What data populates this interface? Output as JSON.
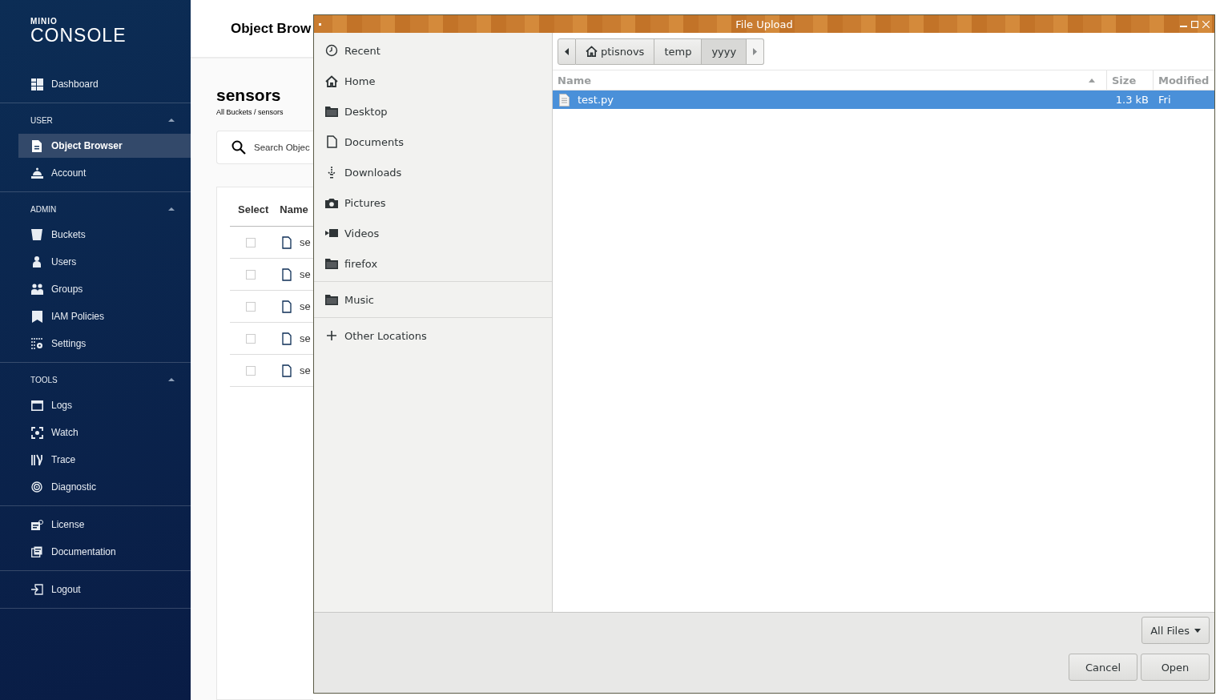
{
  "sidebar": {
    "logo_small": "MINIO",
    "logo": "CONSOLE",
    "sections": [
      {
        "items": [
          {
            "label": "Dashboard",
            "selected": false
          }
        ]
      },
      {
        "title": "USER",
        "expanded": true,
        "items": [
          {
            "label": "Object Browser",
            "selected": true
          },
          {
            "label": "Account",
            "selected": false
          }
        ]
      },
      {
        "title": "ADMIN",
        "expanded": true,
        "items": [
          {
            "label": "Buckets",
            "selected": false
          },
          {
            "label": "Users",
            "selected": false
          },
          {
            "label": "Groups",
            "selected": false
          },
          {
            "label": "IAM Policies",
            "selected": false
          },
          {
            "label": "Settings",
            "selected": false
          }
        ]
      },
      {
        "title": "TOOLS",
        "expanded": true,
        "items": [
          {
            "label": "Logs",
            "selected": false
          },
          {
            "label": "Watch",
            "selected": false
          },
          {
            "label": "Trace",
            "selected": false
          },
          {
            "label": "Diagnostic",
            "selected": false
          }
        ]
      },
      {
        "items": [
          {
            "label": "License",
            "selected": false
          },
          {
            "label": "Documentation",
            "selected": false
          }
        ]
      },
      {
        "items": [
          {
            "label": "Logout",
            "selected": false
          }
        ]
      }
    ]
  },
  "main": {
    "header_title": "Object Brow",
    "bucket": "sensors",
    "breadcrumb": "All Buckets / sensors",
    "search": {
      "placeholder": "Search Objec"
    },
    "table": {
      "columns": [
        "Select",
        "Name"
      ],
      "rows": [
        {
          "checked": false,
          "name": "se"
        },
        {
          "checked": false,
          "name": "se"
        },
        {
          "checked": false,
          "name": "se"
        },
        {
          "checked": false,
          "name": "se"
        },
        {
          "checked": false,
          "name": "se"
        }
      ]
    }
  },
  "dialog": {
    "title": "File Upload",
    "places": [
      [
        {
          "label": "Recent"
        },
        {
          "label": "Home"
        },
        {
          "label": "Desktop"
        },
        {
          "label": "Documents"
        },
        {
          "label": "Downloads"
        },
        {
          "label": "Pictures"
        },
        {
          "label": "Videos"
        },
        {
          "label": "firefox"
        }
      ],
      [
        {
          "label": "Music"
        }
      ],
      [
        {
          "label": "Other Locations"
        }
      ]
    ],
    "path": [
      {
        "label": "ptisnovs",
        "kind": "home",
        "selected": false
      },
      {
        "label": "temp",
        "kind": "folder",
        "selected": false
      },
      {
        "label": "yyyy",
        "kind": "folder",
        "selected": true
      }
    ],
    "columns": [
      {
        "label": "Name",
        "sorted": true
      },
      {
        "label": "Size",
        "sorted": false
      },
      {
        "label": "Modified",
        "sorted": false
      }
    ],
    "files": [
      {
        "name": "test.py",
        "size": "1.3 kB",
        "modified": "Fri",
        "selected": true
      }
    ],
    "filter": "All Files",
    "buttons": [
      "Cancel",
      "Open"
    ]
  }
}
